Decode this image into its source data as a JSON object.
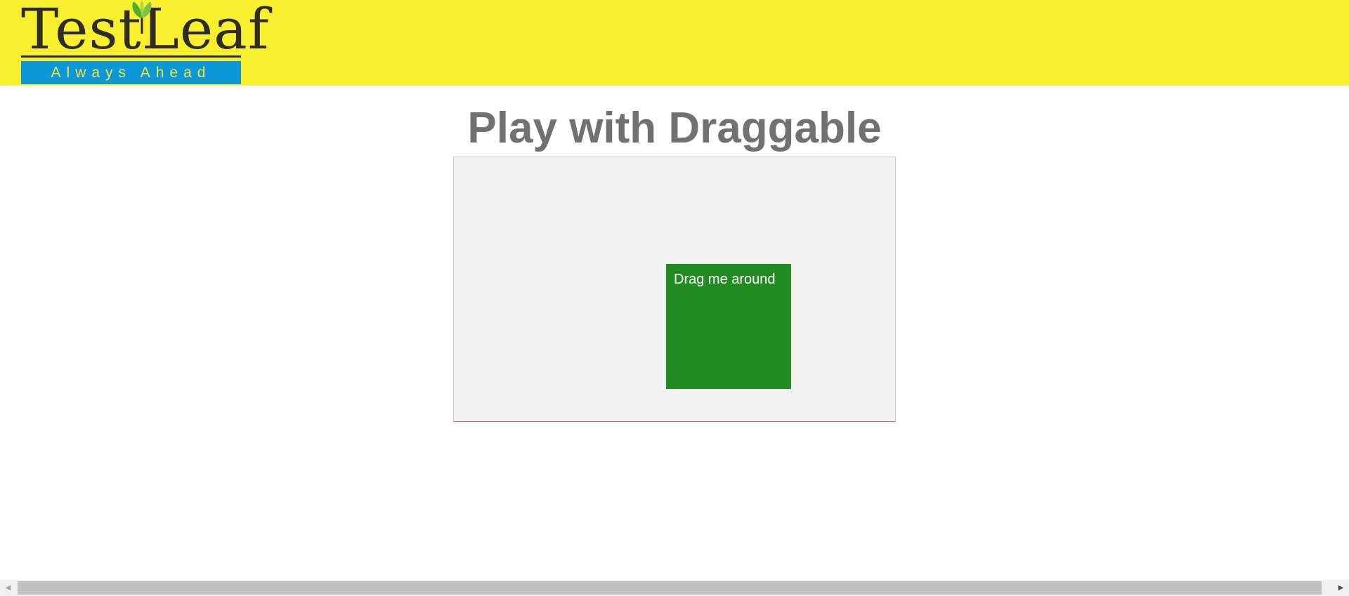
{
  "header": {
    "logo_text_left": "Test",
    "logo_text_right": "Leaf",
    "logo_tagline": "Always Ahead",
    "background_color": "#f8ef2f",
    "tagline_bg_color": "#0b97d8",
    "leaf_icon": "leaf-icon"
  },
  "main": {
    "title": "Play with Draggable",
    "draggable_label": "Drag me around",
    "draggable_color": "#228b22"
  },
  "scrollbar": {
    "left_arrow": "◀",
    "right_arrow": "▶"
  }
}
